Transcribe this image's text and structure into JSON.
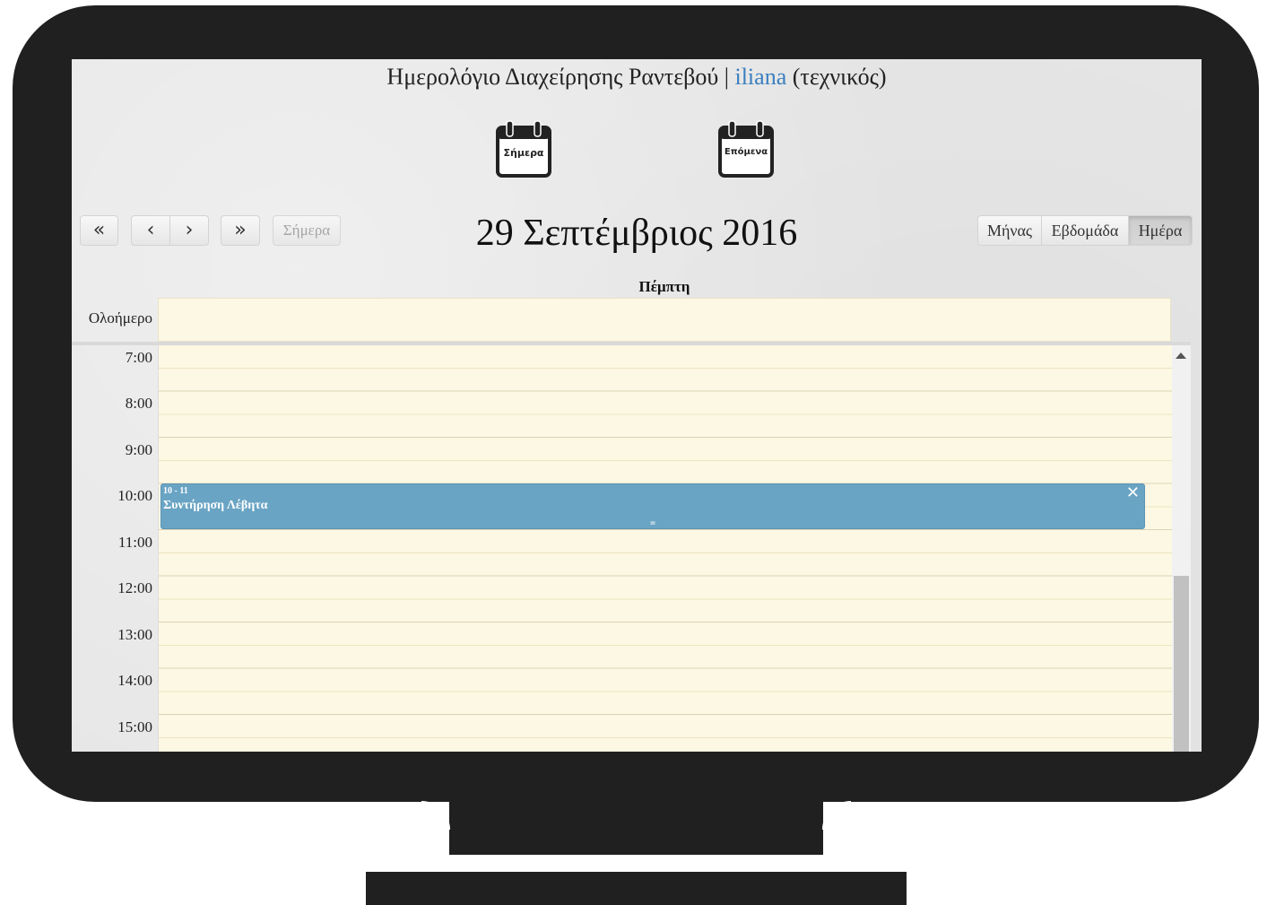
{
  "header": {
    "title": "Ημερολόγιο Διαχείρησης Ραντεβού",
    "separator": "|",
    "username": "iliana",
    "role": "(τεχνικός)"
  },
  "shortcuts": {
    "today_label": "Σήμερα",
    "next_label": "Επόμενα"
  },
  "toolbar": {
    "prev_year": "«",
    "prev": "‹",
    "next": "›",
    "next_year": "»",
    "today": "Σήμερα",
    "date_title": "29 Σεπτέμβριος 2016",
    "views": {
      "month": "Μήνας",
      "week": "Εβδομάδα",
      "day": "Ημέρα"
    },
    "active_view": "day"
  },
  "calendar": {
    "day_header": "Πέμπτη",
    "all_day_label": "Ολοήμερο",
    "hours": [
      "7:00",
      "8:00",
      "9:00",
      "10:00",
      "11:00",
      "12:00",
      "13:00",
      "14:00",
      "15:00"
    ],
    "events": [
      {
        "time": "10 - 11",
        "title": "Συντήρηση Λέβητα",
        "close": "✕",
        "resize": "="
      }
    ]
  },
  "colors": {
    "event_bg": "#6aa4c4",
    "grid_bg": "#fcf8e3",
    "username": "#3a7fbf",
    "monitor": "#202020"
  }
}
